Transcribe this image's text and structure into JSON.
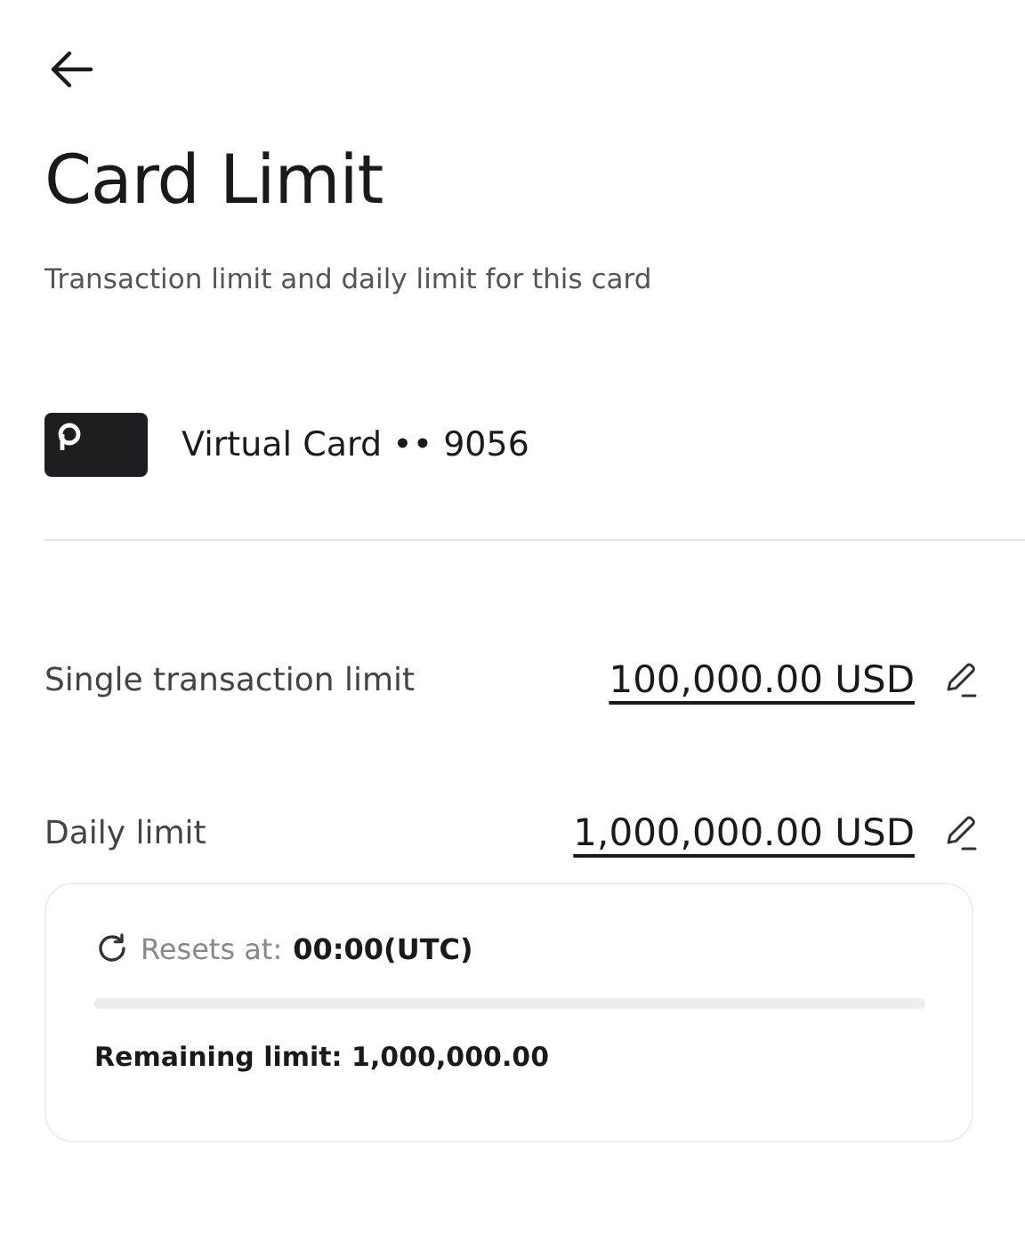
{
  "title": "Card Limit",
  "subtitle": "Transaction limit and daily limit for this card",
  "card": {
    "name": "Virtual Card •• 9056"
  },
  "limits": [
    {
      "label": "Single transaction limit",
      "value": "100,000.00 USD"
    },
    {
      "label": "Daily limit",
      "value": "1,000,000.00 USD"
    }
  ],
  "daily_panel": {
    "resets_label": "Resets at:",
    "resets_time": "00:00(UTC)",
    "level": 0,
    "remaining": "Remaining limit: 1,000,000.00"
  }
}
